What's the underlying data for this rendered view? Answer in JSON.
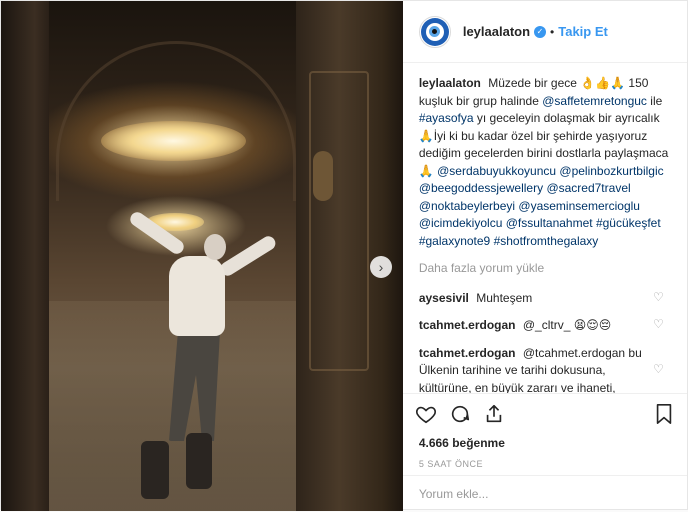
{
  "post": {
    "username": "leylaalaton",
    "follow_label": "Takip Et",
    "caption": {
      "author": "leylaalaton",
      "line1": "Müzede bir gece 👌👍🙏 150 kuşluk bir grup halinde",
      "mention1": "@saffetemretonguc",
      "text2": "ile",
      "hashtag1": "#ayasofya",
      "text3": "yı geceleyin dolaşmak bir ayrıcalık🙏İyi ki bu kadar özel bir şehirde yaşıyoruz dediğim gecelerden birini dostlarla paylaşmaca🙏",
      "tags": [
        "@serdabuyukkoyuncu",
        "@pelinbozkurtbilgic",
        "@beegoddessjewellery",
        "@sacred7travel",
        "@noktabeylerbeyi",
        "@yaseminsemercioglu",
        "@icimdekiyolcu",
        "@fssultanahmet",
        "#gücükeşfet",
        "#galaxynote9",
        "#shotfromthegalaxy"
      ]
    },
    "load_more_label": "Daha fazla yorum yükle",
    "comments": [
      {
        "user": "aysesivil",
        "text": "Muhteşem"
      },
      {
        "user": "tcahmet.erdogan",
        "text": "@_cltrv_ 😫😌😔"
      },
      {
        "user": "tcahmet.erdogan",
        "text": "@tcahmet.erdogan bu Ülkenin tarihine ve tarihi dokusuna, kültürüne, en büyük zararı ve ihaneti, mütaa it lerle işbirliği yapan \"mimar\""
      }
    ],
    "likes": "4.666 beğenme",
    "time": "5 SAAT ÖNCE",
    "add_comment_placeholder": "Yorum ekle..."
  },
  "icons": [
    "heart-icon",
    "comment-icon",
    "share-icon",
    "bookmark-icon",
    "next-arrow-icon",
    "verified-badge-icon"
  ],
  "colors": {
    "accent": "#3897f0",
    "link": "#003569",
    "muted": "#999999"
  }
}
